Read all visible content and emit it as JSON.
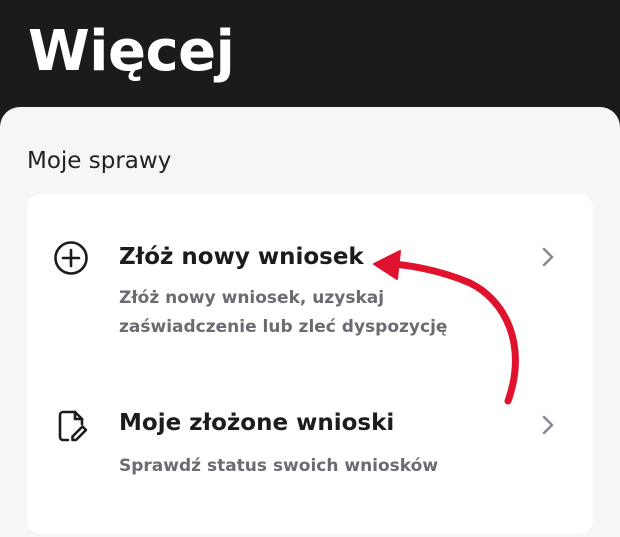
{
  "header": {
    "title": "Więcej"
  },
  "section": {
    "title": "Moje sprawy"
  },
  "items": [
    {
      "title": "Złóż nowy wniosek",
      "description": "Złóż nowy wniosek, uzyskaj zaświadczenie lub zleć dyspozycję",
      "icon": "plus-circle-icon"
    },
    {
      "title": "Moje złożone wnioski",
      "description": "Sprawdź status swoich wniosków",
      "icon": "document-edit-icon"
    }
  ],
  "colors": {
    "header_bg": "#1b1b1d",
    "sheet_bg": "#f6f6f8",
    "card_bg": "#ffffff",
    "annotation_arrow": "#e0122d"
  }
}
